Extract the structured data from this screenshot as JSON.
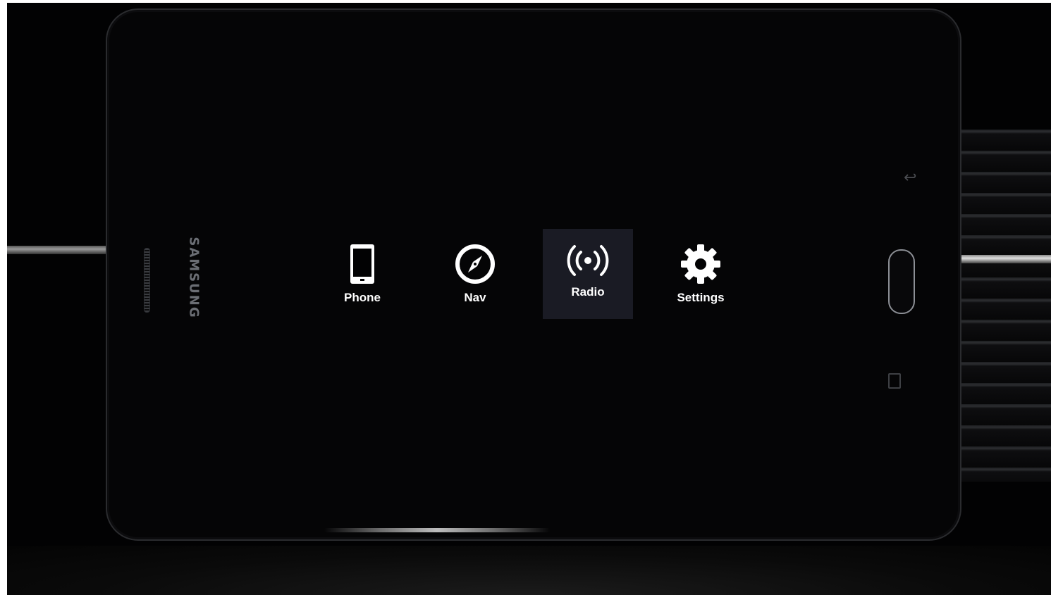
{
  "device": {
    "brand": "SAMSUNG"
  },
  "launcher": {
    "apps": [
      {
        "label": "Phone",
        "icon": "smartphone-icon",
        "selected": false
      },
      {
        "label": "Nav",
        "icon": "compass-icon",
        "selected": false
      },
      {
        "label": "Radio",
        "icon": "radio-broadcast-icon",
        "selected": true
      },
      {
        "label": "Settings",
        "icon": "gear-icon",
        "selected": false
      }
    ]
  },
  "colors": {
    "screen_background": "#020203",
    "selected_tile": "#1a1b24",
    "label_text": "#ffffff"
  }
}
